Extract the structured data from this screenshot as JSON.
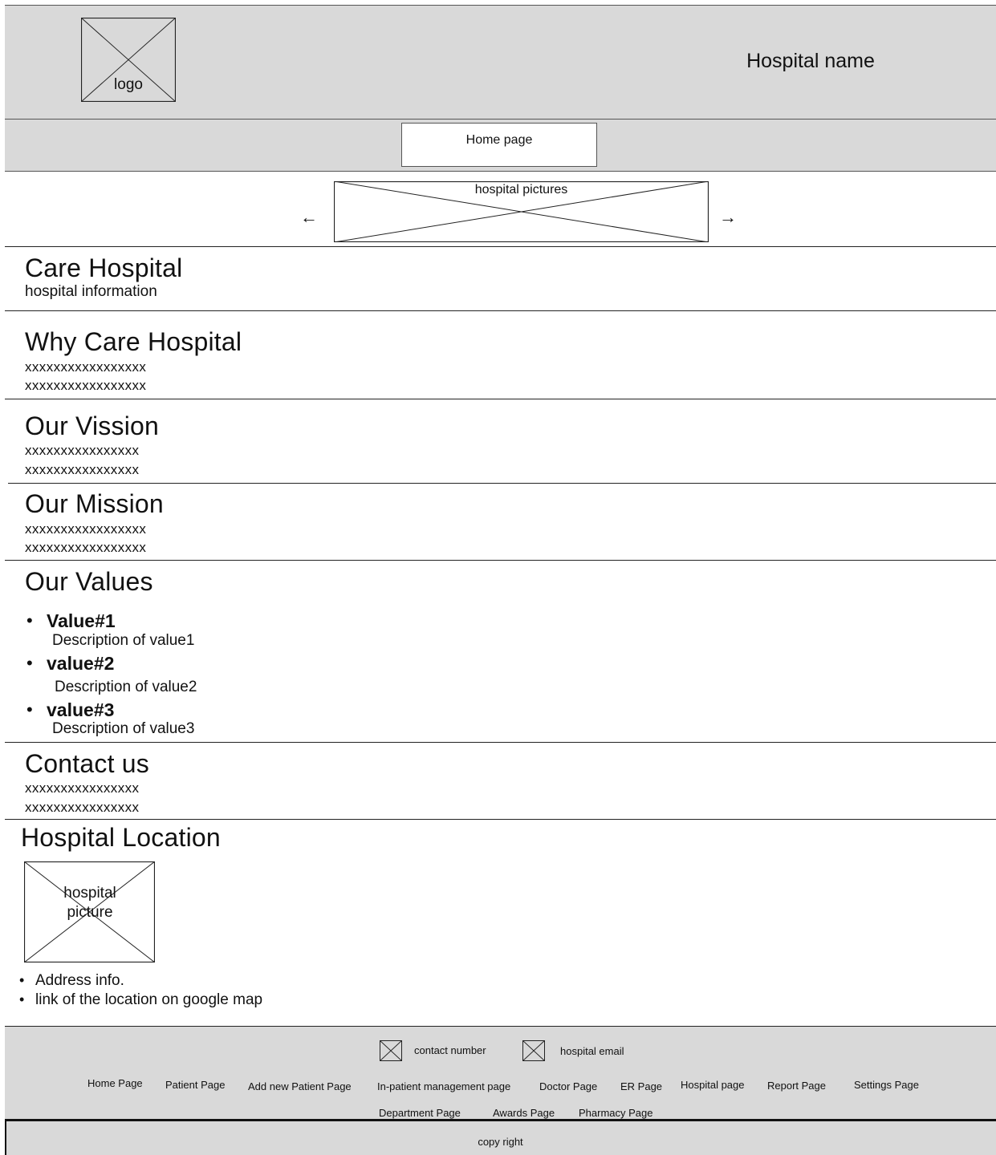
{
  "header": {
    "logo_label": "logo",
    "hospital_name": "Hospital name"
  },
  "nav": {
    "home_label": "Home page"
  },
  "carousel": {
    "label": "hospital pictures",
    "prev": "←",
    "next": "→"
  },
  "about": {
    "title": "Care Hospital",
    "text": "hospital information"
  },
  "why": {
    "title": "Why Care Hospital",
    "lines": [
      "xxxxxxxxxxxxxxxxx",
      "xxxxxxxxxxxxxxxxx"
    ]
  },
  "vision": {
    "title": "Our Vission",
    "lines": [
      "xxxxxxxxxxxxxxxx",
      "xxxxxxxxxxxxxxxx"
    ]
  },
  "mission": {
    "title": "Our Mission",
    "lines": [
      "xxxxxxxxxxxxxxxxx",
      "xxxxxxxxxxxxxxxxx"
    ]
  },
  "values": {
    "title": "Our Values",
    "items": [
      {
        "title": "Value#1",
        "desc": "Description of value1"
      },
      {
        "title": "value#2",
        "desc": "Description of value2"
      },
      {
        "title": "value#3",
        "desc": "Description of value3"
      }
    ]
  },
  "contact": {
    "title": "Contact us",
    "lines": [
      "xxxxxxxxxxxxxxxx",
      "xxxxxxxxxxxxxxxx"
    ]
  },
  "location": {
    "title": "Hospital Location",
    "picture_label": "hospital\npicture",
    "items": [
      "Address info.",
      "link of the location on google map"
    ]
  },
  "footer": {
    "contact_number": "contact number",
    "email": "hospital email",
    "links": [
      "Home Page",
      "Patient  Page",
      "Add new Patient  Page",
      "In-patient management page",
      "Doctor Page",
      "ER Page",
      "Hospital page",
      "Report Page",
      "Settings Page",
      "Department Page",
      "Awards Page",
      "Pharmacy Page"
    ],
    "copyright": "copy right"
  },
  "colors": {
    "band": "#d9d9d9",
    "line": "#222222"
  }
}
